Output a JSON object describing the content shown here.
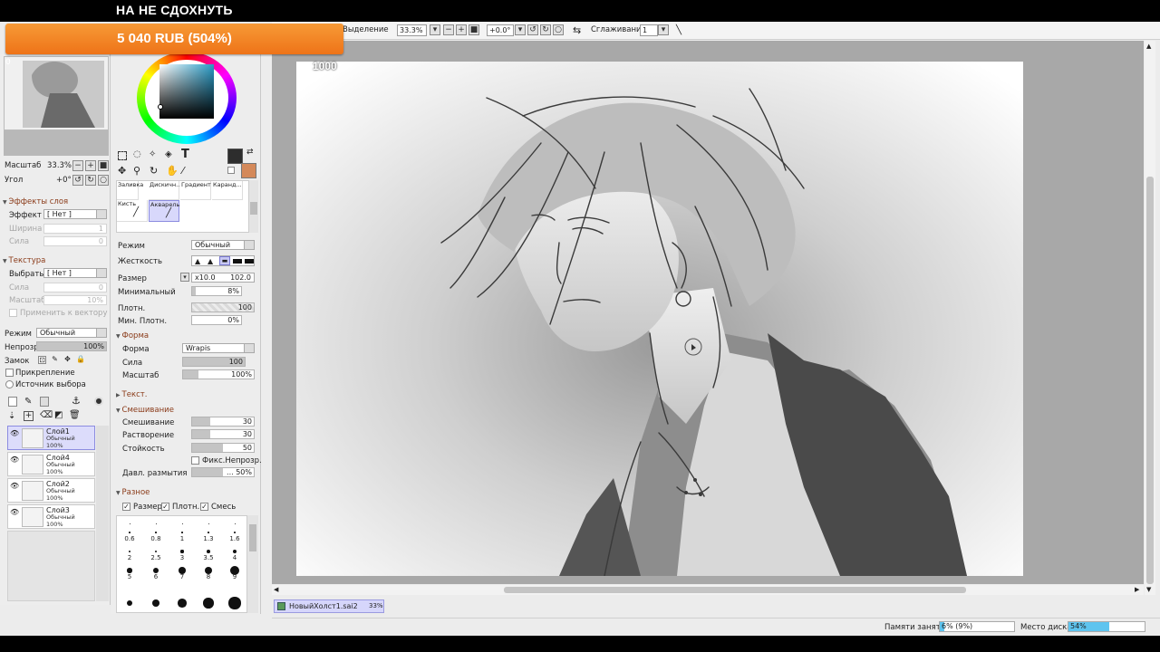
{
  "stream": {
    "title": "НА НЕ СДОХНУТЬ",
    "donation": "5 040 RUB (504%)"
  },
  "toolbar": {
    "selection_label": "Выделение",
    "zoom": "33.3%",
    "angle": "+0.0°",
    "smoothing_label": "Сглаживание",
    "smoothing_value": "1"
  },
  "navigator": {
    "num": "0",
    "zoom_label": "Масштаб",
    "zoom_value": "33.3%",
    "angle_label": "Угол",
    "angle_value": "+0°"
  },
  "layer_effects": {
    "header": "Эффекты слоя",
    "effect_label": "Эффект",
    "effect_value": "[ Нет ]",
    "width_label": "Ширина",
    "width_value": "1",
    "strength_label": "Сила",
    "strength_value": "0"
  },
  "texture": {
    "header": "Текстура",
    "select_label": "Выбрать",
    "select_value": "[ Нет ]",
    "strength_label": "Сила",
    "strength_value": "0",
    "scale_label": "Масштаб",
    "scale_value": "10%",
    "apply_vector": "Применить к вектору"
  },
  "layer_props": {
    "mode_label": "Режим",
    "mode_value": "Обычный",
    "opacity_label": "Непрозр.",
    "opacity_value": "100%",
    "opacity_fraction": 1.0,
    "lock_label": "Замок",
    "clip_label": "Прикрепление",
    "source_label": "Источник выбора"
  },
  "layers": [
    {
      "name": "Слой1",
      "mode": "Обычный",
      "opacity": "100%",
      "selected": true
    },
    {
      "name": "Слой4",
      "mode": "Обычный",
      "opacity": "100%",
      "selected": false
    },
    {
      "name": "Слой2",
      "mode": "Обычный",
      "opacity": "100%",
      "selected": false
    },
    {
      "name": "Слой3",
      "mode": "Обычный",
      "opacity": "100%",
      "selected": false
    }
  ],
  "colors": {
    "primary": "#2d2d2d",
    "secondary": "#d4895a",
    "picker_hue": "#2a9cc7"
  },
  "brushes": {
    "top_row": [
      "Заливка",
      "Дискичн...",
      "Градиент",
      "Каранд..."
    ],
    "brush": "Кисть",
    "watercolor": "Акварель"
  },
  "brush_settings": {
    "mode_label": "Режим",
    "mode_value": "Обычный",
    "hardness_label": "Жесткость",
    "size_label": "Размер",
    "size_mult": "x10.0",
    "size_value": "102.0",
    "min_label": "Минимальный",
    "min_value": "8%",
    "min_fraction": 0.08,
    "density_label": "Плотн.",
    "density_value": "100",
    "min_density_label": "Мин. Плотн.",
    "min_density_value": "0%"
  },
  "shape": {
    "header": "Форма",
    "shape_label": "Форма",
    "shape_value": "Wrapis",
    "strength_label": "Сила",
    "strength_value": "100",
    "strength_fraction": 1.0,
    "scale_label": "Масштаб",
    "scale_value": "100%",
    "scale_fraction": 0.22
  },
  "text_section": {
    "header": "Текст."
  },
  "blending": {
    "header": "Смешивание",
    "mix_label": "Смешивание",
    "mix_value": "30",
    "mix_fraction": 0.3,
    "dilution_label": "Растворение",
    "dilution_value": "30",
    "dilution_fraction": 0.3,
    "persistence_label": "Стойкость",
    "persistence_value": "50",
    "persistence_fraction": 0.5,
    "fix_label": "Фикс.Непрозр.",
    "blur_label": "Давл. размытия",
    "blur_value": "... 50%",
    "blur_fraction": 0.5
  },
  "misc": {
    "header": "Разное",
    "size_chk": "Размер",
    "density_chk": "Плотн.",
    "mix_chk": "Смесь"
  },
  "brush_sizes": [
    "0.6",
    "0.8",
    "1",
    "1.3",
    "1.6",
    "2",
    "2.5",
    "3",
    "3.5",
    "4",
    "5",
    "6",
    "7",
    "8",
    "9"
  ],
  "canvas": {
    "zoom_overlay": "1000"
  },
  "document": {
    "tab_name": "НовыйХолст1.sai2",
    "tab_zoom": "33%"
  },
  "status": {
    "memory_label": "Памяти занято",
    "memory_value": "6% (9%)",
    "memory_fraction": 0.06,
    "disk_label": "Место диска",
    "disk_value": "54%",
    "disk_fraction": 0.54
  }
}
